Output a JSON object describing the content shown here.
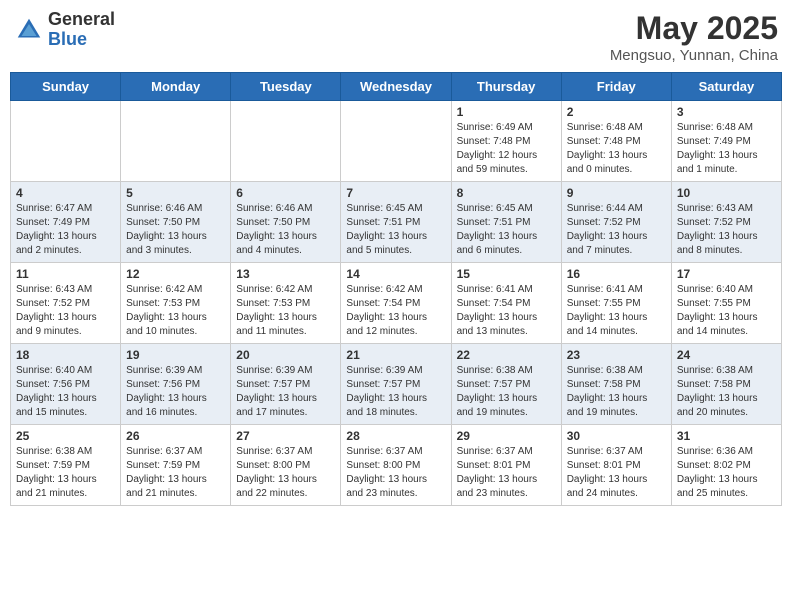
{
  "header": {
    "logo_general": "General",
    "logo_blue": "Blue",
    "month_title": "May 2025",
    "subtitle": "Mengsuo, Yunnan, China"
  },
  "weekdays": [
    "Sunday",
    "Monday",
    "Tuesday",
    "Wednesday",
    "Thursday",
    "Friday",
    "Saturday"
  ],
  "weeks": [
    [
      {
        "day": "",
        "info": ""
      },
      {
        "day": "",
        "info": ""
      },
      {
        "day": "",
        "info": ""
      },
      {
        "day": "",
        "info": ""
      },
      {
        "day": "1",
        "info": "Sunrise: 6:49 AM\nSunset: 7:48 PM\nDaylight: 12 hours and 59 minutes."
      },
      {
        "day": "2",
        "info": "Sunrise: 6:48 AM\nSunset: 7:48 PM\nDaylight: 13 hours and 0 minutes."
      },
      {
        "day": "3",
        "info": "Sunrise: 6:48 AM\nSunset: 7:49 PM\nDaylight: 13 hours and 1 minute."
      }
    ],
    [
      {
        "day": "4",
        "info": "Sunrise: 6:47 AM\nSunset: 7:49 PM\nDaylight: 13 hours and 2 minutes."
      },
      {
        "day": "5",
        "info": "Sunrise: 6:46 AM\nSunset: 7:50 PM\nDaylight: 13 hours and 3 minutes."
      },
      {
        "day": "6",
        "info": "Sunrise: 6:46 AM\nSunset: 7:50 PM\nDaylight: 13 hours and 4 minutes."
      },
      {
        "day": "7",
        "info": "Sunrise: 6:45 AM\nSunset: 7:51 PM\nDaylight: 13 hours and 5 minutes."
      },
      {
        "day": "8",
        "info": "Sunrise: 6:45 AM\nSunset: 7:51 PM\nDaylight: 13 hours and 6 minutes."
      },
      {
        "day": "9",
        "info": "Sunrise: 6:44 AM\nSunset: 7:52 PM\nDaylight: 13 hours and 7 minutes."
      },
      {
        "day": "10",
        "info": "Sunrise: 6:43 AM\nSunset: 7:52 PM\nDaylight: 13 hours and 8 minutes."
      }
    ],
    [
      {
        "day": "11",
        "info": "Sunrise: 6:43 AM\nSunset: 7:52 PM\nDaylight: 13 hours and 9 minutes."
      },
      {
        "day": "12",
        "info": "Sunrise: 6:42 AM\nSunset: 7:53 PM\nDaylight: 13 hours and 10 minutes."
      },
      {
        "day": "13",
        "info": "Sunrise: 6:42 AM\nSunset: 7:53 PM\nDaylight: 13 hours and 11 minutes."
      },
      {
        "day": "14",
        "info": "Sunrise: 6:42 AM\nSunset: 7:54 PM\nDaylight: 13 hours and 12 minutes."
      },
      {
        "day": "15",
        "info": "Sunrise: 6:41 AM\nSunset: 7:54 PM\nDaylight: 13 hours and 13 minutes."
      },
      {
        "day": "16",
        "info": "Sunrise: 6:41 AM\nSunset: 7:55 PM\nDaylight: 13 hours and 14 minutes."
      },
      {
        "day": "17",
        "info": "Sunrise: 6:40 AM\nSunset: 7:55 PM\nDaylight: 13 hours and 14 minutes."
      }
    ],
    [
      {
        "day": "18",
        "info": "Sunrise: 6:40 AM\nSunset: 7:56 PM\nDaylight: 13 hours and 15 minutes."
      },
      {
        "day": "19",
        "info": "Sunrise: 6:39 AM\nSunset: 7:56 PM\nDaylight: 13 hours and 16 minutes."
      },
      {
        "day": "20",
        "info": "Sunrise: 6:39 AM\nSunset: 7:57 PM\nDaylight: 13 hours and 17 minutes."
      },
      {
        "day": "21",
        "info": "Sunrise: 6:39 AM\nSunset: 7:57 PM\nDaylight: 13 hours and 18 minutes."
      },
      {
        "day": "22",
        "info": "Sunrise: 6:38 AM\nSunset: 7:57 PM\nDaylight: 13 hours and 19 minutes."
      },
      {
        "day": "23",
        "info": "Sunrise: 6:38 AM\nSunset: 7:58 PM\nDaylight: 13 hours and 19 minutes."
      },
      {
        "day": "24",
        "info": "Sunrise: 6:38 AM\nSunset: 7:58 PM\nDaylight: 13 hours and 20 minutes."
      }
    ],
    [
      {
        "day": "25",
        "info": "Sunrise: 6:38 AM\nSunset: 7:59 PM\nDaylight: 13 hours and 21 minutes."
      },
      {
        "day": "26",
        "info": "Sunrise: 6:37 AM\nSunset: 7:59 PM\nDaylight: 13 hours and 21 minutes."
      },
      {
        "day": "27",
        "info": "Sunrise: 6:37 AM\nSunset: 8:00 PM\nDaylight: 13 hours and 22 minutes."
      },
      {
        "day": "28",
        "info": "Sunrise: 6:37 AM\nSunset: 8:00 PM\nDaylight: 13 hours and 23 minutes."
      },
      {
        "day": "29",
        "info": "Sunrise: 6:37 AM\nSunset: 8:01 PM\nDaylight: 13 hours and 23 minutes."
      },
      {
        "day": "30",
        "info": "Sunrise: 6:37 AM\nSunset: 8:01 PM\nDaylight: 13 hours and 24 minutes."
      },
      {
        "day": "31",
        "info": "Sunrise: 6:36 AM\nSunset: 8:02 PM\nDaylight: 13 hours and 25 minutes."
      }
    ]
  ]
}
